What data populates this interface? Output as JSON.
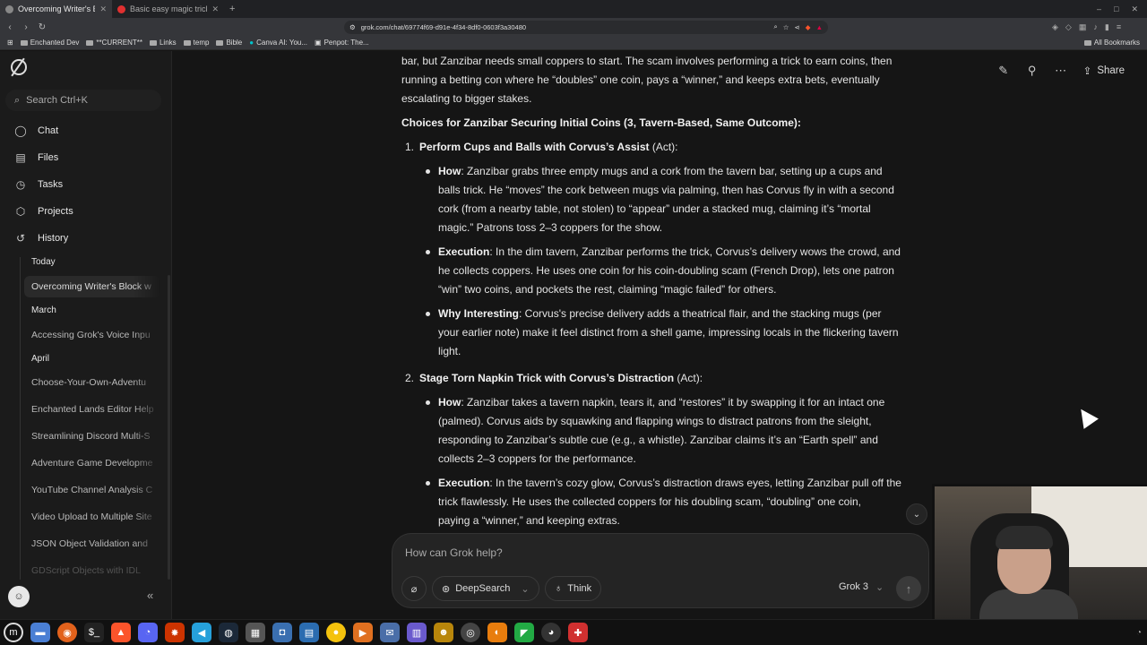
{
  "browser": {
    "tabs": [
      {
        "label": "Overcoming Writer's B",
        "active": true
      },
      {
        "label": "Basic easy magic tricks - Y",
        "active": false
      }
    ],
    "url": "grok.com/chat/69774f69-d91e-4f34-8df0-0603f3a30480",
    "bookmarks": [
      "Enchanted Dev",
      "**CURRENT**",
      "Links",
      "temp",
      "Bible",
      "Canva AI: You...",
      "Penpot: The..."
    ],
    "all_bookmarks": "All Bookmarks"
  },
  "sidebar": {
    "search_placeholder": "Search Ctrl+K",
    "nav": [
      "Chat",
      "Files",
      "Tasks",
      "Projects",
      "History"
    ],
    "groups": {
      "today": "Today",
      "march": "March",
      "april": "April"
    },
    "history": {
      "today": [
        "Overcoming Writer's Block w"
      ],
      "march": [
        "Accessing Grok's Voice Inpu"
      ],
      "april": [
        "Choose-Your-Own-Adventu",
        "Enchanted Lands Editor Help",
        "Streamlining Discord Multi-S",
        "Adventure Game Developme",
        "YouTube Channel Analysis C",
        "Video Upload to Multiple Site",
        "JSON Object Validation and",
        "GDScript Objects with IDL"
      ]
    }
  },
  "header": {
    "share_label": "Share"
  },
  "message": {
    "intro_1": "bar, but Zanzibar needs small coppers to start. The scam involves performing a trick to earn coins, then",
    "intro_2": "running a betting con where he “doubles” one coin, pays a “winner,” and keeps extra bets, eventually",
    "intro_3": "escalating to bigger stakes.",
    "choices_heading": "Choices for Zanzibar Securing Initial Coins (3, Tavern-Based, Same Outcome):",
    "items": [
      {
        "num": "1.",
        "title": "Perform Cups and Balls with Corvus’s Assist",
        "tag": " (Act):",
        "bullets": [
          {
            "label": "How",
            "lines": [
              ": Zanzibar grabs three empty mugs and a cork from the tavern bar, setting up a cups and",
              "balls trick. He “moves” the cork between mugs via palming, then has Corvus fly in with a second",
              "cork (from a nearby table, not stolen) to “appear” under a stacked mug, claiming it’s “mortal",
              "magic.” Patrons toss 2–3 coppers for the show."
            ]
          },
          {
            "label": "Execution",
            "lines": [
              ": In the dim tavern, Zanzibar performs the trick, Corvus’s delivery wows the crowd, and",
              "he collects coppers. He uses one coin for his coin-doubling scam (French Drop), lets one patron",
              "“win” two coins, and pockets the rest, claiming “magic failed” for others."
            ]
          },
          {
            "label": "Why Interesting",
            "lines": [
              ": Corvus's precise delivery adds a theatrical flair, and the stacking mugs (per",
              "your earlier note) make it feel distinct from a shell game, impressing locals in the flickering tavern",
              "light."
            ]
          }
        ]
      },
      {
        "num": "2.",
        "title": "Stage Torn Napkin Trick with Corvus’s Distraction",
        "tag": " (Act):",
        "bullets": [
          {
            "label": "How",
            "lines": [
              ": Zanzibar takes a tavern napkin, tears it, and “restores” it by swapping it for an intact one",
              "(palmed). Corvus aids by squawking and flapping wings to distract patrons from the sleight,",
              "responding to Zanzibar’s subtle cue (e.g., a whistle). Zanzibar claims it’s an “Earth spell” and",
              "collects 2–3 coppers for the performance."
            ]
          },
          {
            "label": "Execution",
            "lines": [
              ": In the tavern’s cozy glow, Corvus’s distraction draws eyes, letting Zanzibar pull off the",
              "trick flawlessly. He uses the collected coppers for his doubling scam, “doubling” one coin,",
              "paying a “winner,” and keeping extras."
            ]
          }
        ]
      }
    ]
  },
  "composer": {
    "placeholder": "How can Grok help?",
    "deepsearch_label": "DeepSearch",
    "think_label": "Think",
    "model_label": "Grok 3"
  }
}
